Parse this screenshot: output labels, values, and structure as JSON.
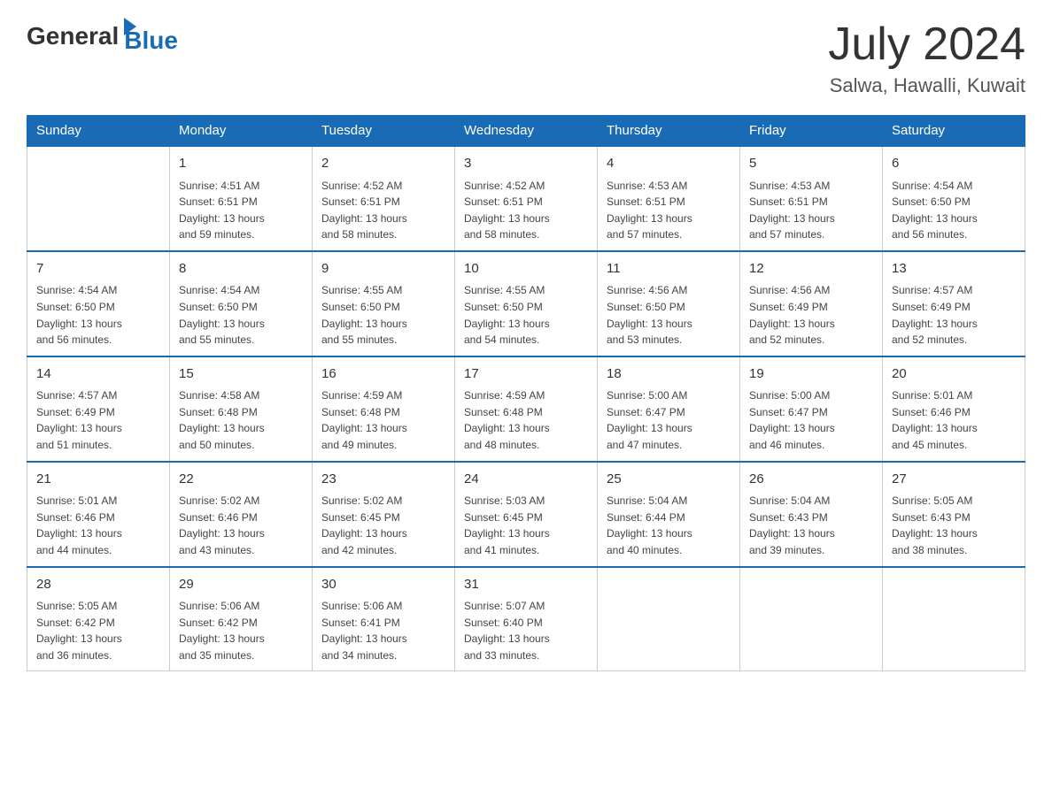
{
  "logo": {
    "text_general": "General",
    "text_blue": "Blue"
  },
  "title": {
    "month_year": "July 2024",
    "location": "Salwa, Hawalli, Kuwait"
  },
  "weekdays": [
    "Sunday",
    "Monday",
    "Tuesday",
    "Wednesday",
    "Thursday",
    "Friday",
    "Saturday"
  ],
  "weeks": [
    [
      {
        "day": "",
        "info": ""
      },
      {
        "day": "1",
        "info": "Sunrise: 4:51 AM\nSunset: 6:51 PM\nDaylight: 13 hours\nand 59 minutes."
      },
      {
        "day": "2",
        "info": "Sunrise: 4:52 AM\nSunset: 6:51 PM\nDaylight: 13 hours\nand 58 minutes."
      },
      {
        "day": "3",
        "info": "Sunrise: 4:52 AM\nSunset: 6:51 PM\nDaylight: 13 hours\nand 58 minutes."
      },
      {
        "day": "4",
        "info": "Sunrise: 4:53 AM\nSunset: 6:51 PM\nDaylight: 13 hours\nand 57 minutes."
      },
      {
        "day": "5",
        "info": "Sunrise: 4:53 AM\nSunset: 6:51 PM\nDaylight: 13 hours\nand 57 minutes."
      },
      {
        "day": "6",
        "info": "Sunrise: 4:54 AM\nSunset: 6:50 PM\nDaylight: 13 hours\nand 56 minutes."
      }
    ],
    [
      {
        "day": "7",
        "info": "Sunrise: 4:54 AM\nSunset: 6:50 PM\nDaylight: 13 hours\nand 56 minutes."
      },
      {
        "day": "8",
        "info": "Sunrise: 4:54 AM\nSunset: 6:50 PM\nDaylight: 13 hours\nand 55 minutes."
      },
      {
        "day": "9",
        "info": "Sunrise: 4:55 AM\nSunset: 6:50 PM\nDaylight: 13 hours\nand 55 minutes."
      },
      {
        "day": "10",
        "info": "Sunrise: 4:55 AM\nSunset: 6:50 PM\nDaylight: 13 hours\nand 54 minutes."
      },
      {
        "day": "11",
        "info": "Sunrise: 4:56 AM\nSunset: 6:50 PM\nDaylight: 13 hours\nand 53 minutes."
      },
      {
        "day": "12",
        "info": "Sunrise: 4:56 AM\nSunset: 6:49 PM\nDaylight: 13 hours\nand 52 minutes."
      },
      {
        "day": "13",
        "info": "Sunrise: 4:57 AM\nSunset: 6:49 PM\nDaylight: 13 hours\nand 52 minutes."
      }
    ],
    [
      {
        "day": "14",
        "info": "Sunrise: 4:57 AM\nSunset: 6:49 PM\nDaylight: 13 hours\nand 51 minutes."
      },
      {
        "day": "15",
        "info": "Sunrise: 4:58 AM\nSunset: 6:48 PM\nDaylight: 13 hours\nand 50 minutes."
      },
      {
        "day": "16",
        "info": "Sunrise: 4:59 AM\nSunset: 6:48 PM\nDaylight: 13 hours\nand 49 minutes."
      },
      {
        "day": "17",
        "info": "Sunrise: 4:59 AM\nSunset: 6:48 PM\nDaylight: 13 hours\nand 48 minutes."
      },
      {
        "day": "18",
        "info": "Sunrise: 5:00 AM\nSunset: 6:47 PM\nDaylight: 13 hours\nand 47 minutes."
      },
      {
        "day": "19",
        "info": "Sunrise: 5:00 AM\nSunset: 6:47 PM\nDaylight: 13 hours\nand 46 minutes."
      },
      {
        "day": "20",
        "info": "Sunrise: 5:01 AM\nSunset: 6:46 PM\nDaylight: 13 hours\nand 45 minutes."
      }
    ],
    [
      {
        "day": "21",
        "info": "Sunrise: 5:01 AM\nSunset: 6:46 PM\nDaylight: 13 hours\nand 44 minutes."
      },
      {
        "day": "22",
        "info": "Sunrise: 5:02 AM\nSunset: 6:46 PM\nDaylight: 13 hours\nand 43 minutes."
      },
      {
        "day": "23",
        "info": "Sunrise: 5:02 AM\nSunset: 6:45 PM\nDaylight: 13 hours\nand 42 minutes."
      },
      {
        "day": "24",
        "info": "Sunrise: 5:03 AM\nSunset: 6:45 PM\nDaylight: 13 hours\nand 41 minutes."
      },
      {
        "day": "25",
        "info": "Sunrise: 5:04 AM\nSunset: 6:44 PM\nDaylight: 13 hours\nand 40 minutes."
      },
      {
        "day": "26",
        "info": "Sunrise: 5:04 AM\nSunset: 6:43 PM\nDaylight: 13 hours\nand 39 minutes."
      },
      {
        "day": "27",
        "info": "Sunrise: 5:05 AM\nSunset: 6:43 PM\nDaylight: 13 hours\nand 38 minutes."
      }
    ],
    [
      {
        "day": "28",
        "info": "Sunrise: 5:05 AM\nSunset: 6:42 PM\nDaylight: 13 hours\nand 36 minutes."
      },
      {
        "day": "29",
        "info": "Sunrise: 5:06 AM\nSunset: 6:42 PM\nDaylight: 13 hours\nand 35 minutes."
      },
      {
        "day": "30",
        "info": "Sunrise: 5:06 AM\nSunset: 6:41 PM\nDaylight: 13 hours\nand 34 minutes."
      },
      {
        "day": "31",
        "info": "Sunrise: 5:07 AM\nSunset: 6:40 PM\nDaylight: 13 hours\nand 33 minutes."
      },
      {
        "day": "",
        "info": ""
      },
      {
        "day": "",
        "info": ""
      },
      {
        "day": "",
        "info": ""
      }
    ]
  ]
}
